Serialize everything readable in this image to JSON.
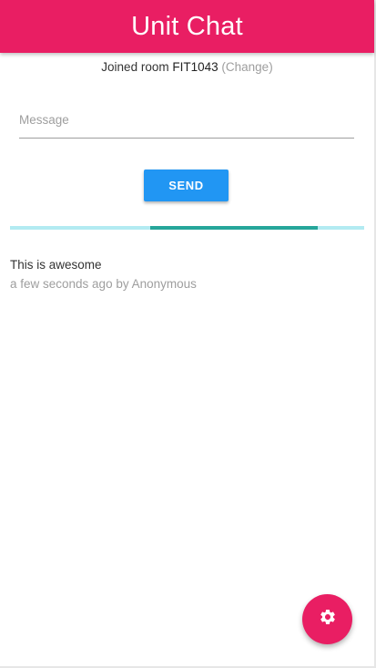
{
  "app_bar": {
    "title": "Unit Chat",
    "color": "#e91e63"
  },
  "room": {
    "prefix": "Joined room",
    "code": "FIT1043",
    "change_label": "(Change)"
  },
  "composer": {
    "message_placeholder": "Message",
    "message_value": "",
    "send_label": "SEND",
    "send_color": "#2196f3"
  },
  "progress": {
    "indeterminate": true,
    "track_color": "#b2ebf2",
    "fill_color": "#26a69a"
  },
  "messages": [
    {
      "text": "This is awesome",
      "meta": "a few seconds ago by Anonymous"
    }
  ],
  "fab": {
    "icon": "gear-icon",
    "color": "#e91e63"
  }
}
